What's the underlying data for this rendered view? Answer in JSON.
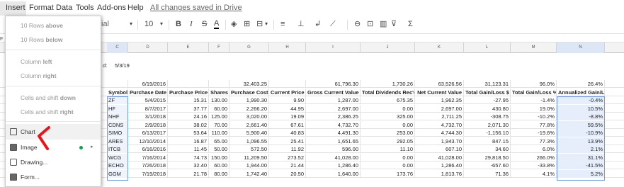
{
  "menubar": {
    "items": [
      "Insert",
      "Format",
      "Data",
      "Tools",
      "Add-ons",
      "Help"
    ],
    "save_status": "All changes saved in Drive"
  },
  "toolbar": {
    "font": "ial",
    "font_size": "10",
    "bold": "B",
    "italic": "I",
    "strike": "S",
    "text_color": "A"
  },
  "insert_menu": {
    "rows_above_count": "10 Rows",
    "rows_above_label": "above",
    "rows_below_count": "10 Rows",
    "rows_below_label": "below",
    "column_left_text": "Column",
    "column_left_label": "left",
    "column_right_text": "Column",
    "column_right_label": "right",
    "cells_down_text": "Cells and shift",
    "cells_down_label": "down",
    "cells_right_text": "Cells and shift",
    "cells_right_label": "right",
    "chart": "Chart",
    "image": "Image",
    "drawing": "Drawing...",
    "form": "Form..."
  },
  "grid": {
    "columns": [
      "C",
      "D",
      "E",
      "F",
      "G",
      "H",
      "I",
      "J",
      "K",
      "L",
      "M",
      "N"
    ],
    "partial_date_label": "d:",
    "partial_date_value": "5/3/19",
    "summary": [
      "",
      "6/19/2016",
      "",
      "",
      "32,403.25",
      "",
      "61,796.30",
      "1,730.26",
      "63,526.56",
      "31,123.31",
      "96.0%",
      "26.4%"
    ],
    "headers": [
      "Symbol",
      "Purchase Date",
      "Purchase Price",
      "Shares",
      "Purchase Cost",
      "Current Price",
      "Gross Current Value",
      "Total Dividends Rec'd",
      "Net Current Value",
      "Total Gain/Loss $",
      "Total Gain/Loss %",
      "Annualized Gain/Loss"
    ],
    "rows": [
      [
        "ZF",
        "5/4/2015",
        "15.31",
        "130.00",
        "1,990.30",
        "9.90",
        "1,287.00",
        "675.35",
        "1,962.35",
        "-27.95",
        "-1.4%",
        "-0.4%"
      ],
      [
        "HF",
        "8/7/2017",
        "37.77",
        "60.00",
        "2,266.20",
        "44.95",
        "2,697.00",
        "0.00",
        "2,697.00",
        "430.80",
        "19.0%",
        "10.5%"
      ],
      [
        "NHF",
        "3/1/2018",
        "24.16",
        "125.00",
        "3,020.00",
        "19.09",
        "2,386.25",
        "325.00",
        "2,711.25",
        "-308.75",
        "-10.2%",
        "-8.8%"
      ],
      [
        "CDNS",
        "2/9/2018",
        "38.02",
        "70.00",
        "2,661.40",
        "67.61",
        "4,732.70",
        "0.00",
        "4,732.70",
        "2,071.30",
        "77.8%",
        "59.5%"
      ],
      [
        "SIMO",
        "6/13/2017",
        "53.64",
        "110.00",
        "5,900.40",
        "40.83",
        "4,491.30",
        "253.00",
        "4,744.30",
        "-1,156.10",
        "-19.6%",
        "-10.9%"
      ],
      [
        "ARES",
        "12/10/2014",
        "16.87",
        "65.00",
        "1,096.55",
        "25.41",
        "1,651.65",
        "292.05",
        "1,943.70",
        "847.15",
        "77.3%",
        "13.9%"
      ],
      [
        "ITCB",
        "6/16/2016",
        "11.45",
        "50.00",
        "572.50",
        "11.92",
        "596.00",
        "11.10",
        "607.10",
        "34.60",
        "6.0%",
        "2.1%"
      ],
      [
        "WCG",
        "7/16/2014",
        "74.73",
        "150.00",
        "11,209.50",
        "273.52",
        "41,028.00",
        "0.00",
        "41,028.00",
        "29,818.50",
        "266.0%",
        "31.1%"
      ],
      [
        "ECHO",
        "7/26/2018",
        "32.40",
        "60.00",
        "1,944.00",
        "21.44",
        "1,286.40",
        "0.00",
        "1,286.40",
        "-657.60",
        "-33.8%",
        "-41.5%"
      ],
      [
        "GGM",
        "7/19/2018",
        "21.78",
        "80.00",
        "1,742.40",
        "20.50",
        "1,640.00",
        "173.76",
        "1,813.76",
        "71.36",
        "4.1%",
        "5.2%"
      ]
    ]
  }
}
